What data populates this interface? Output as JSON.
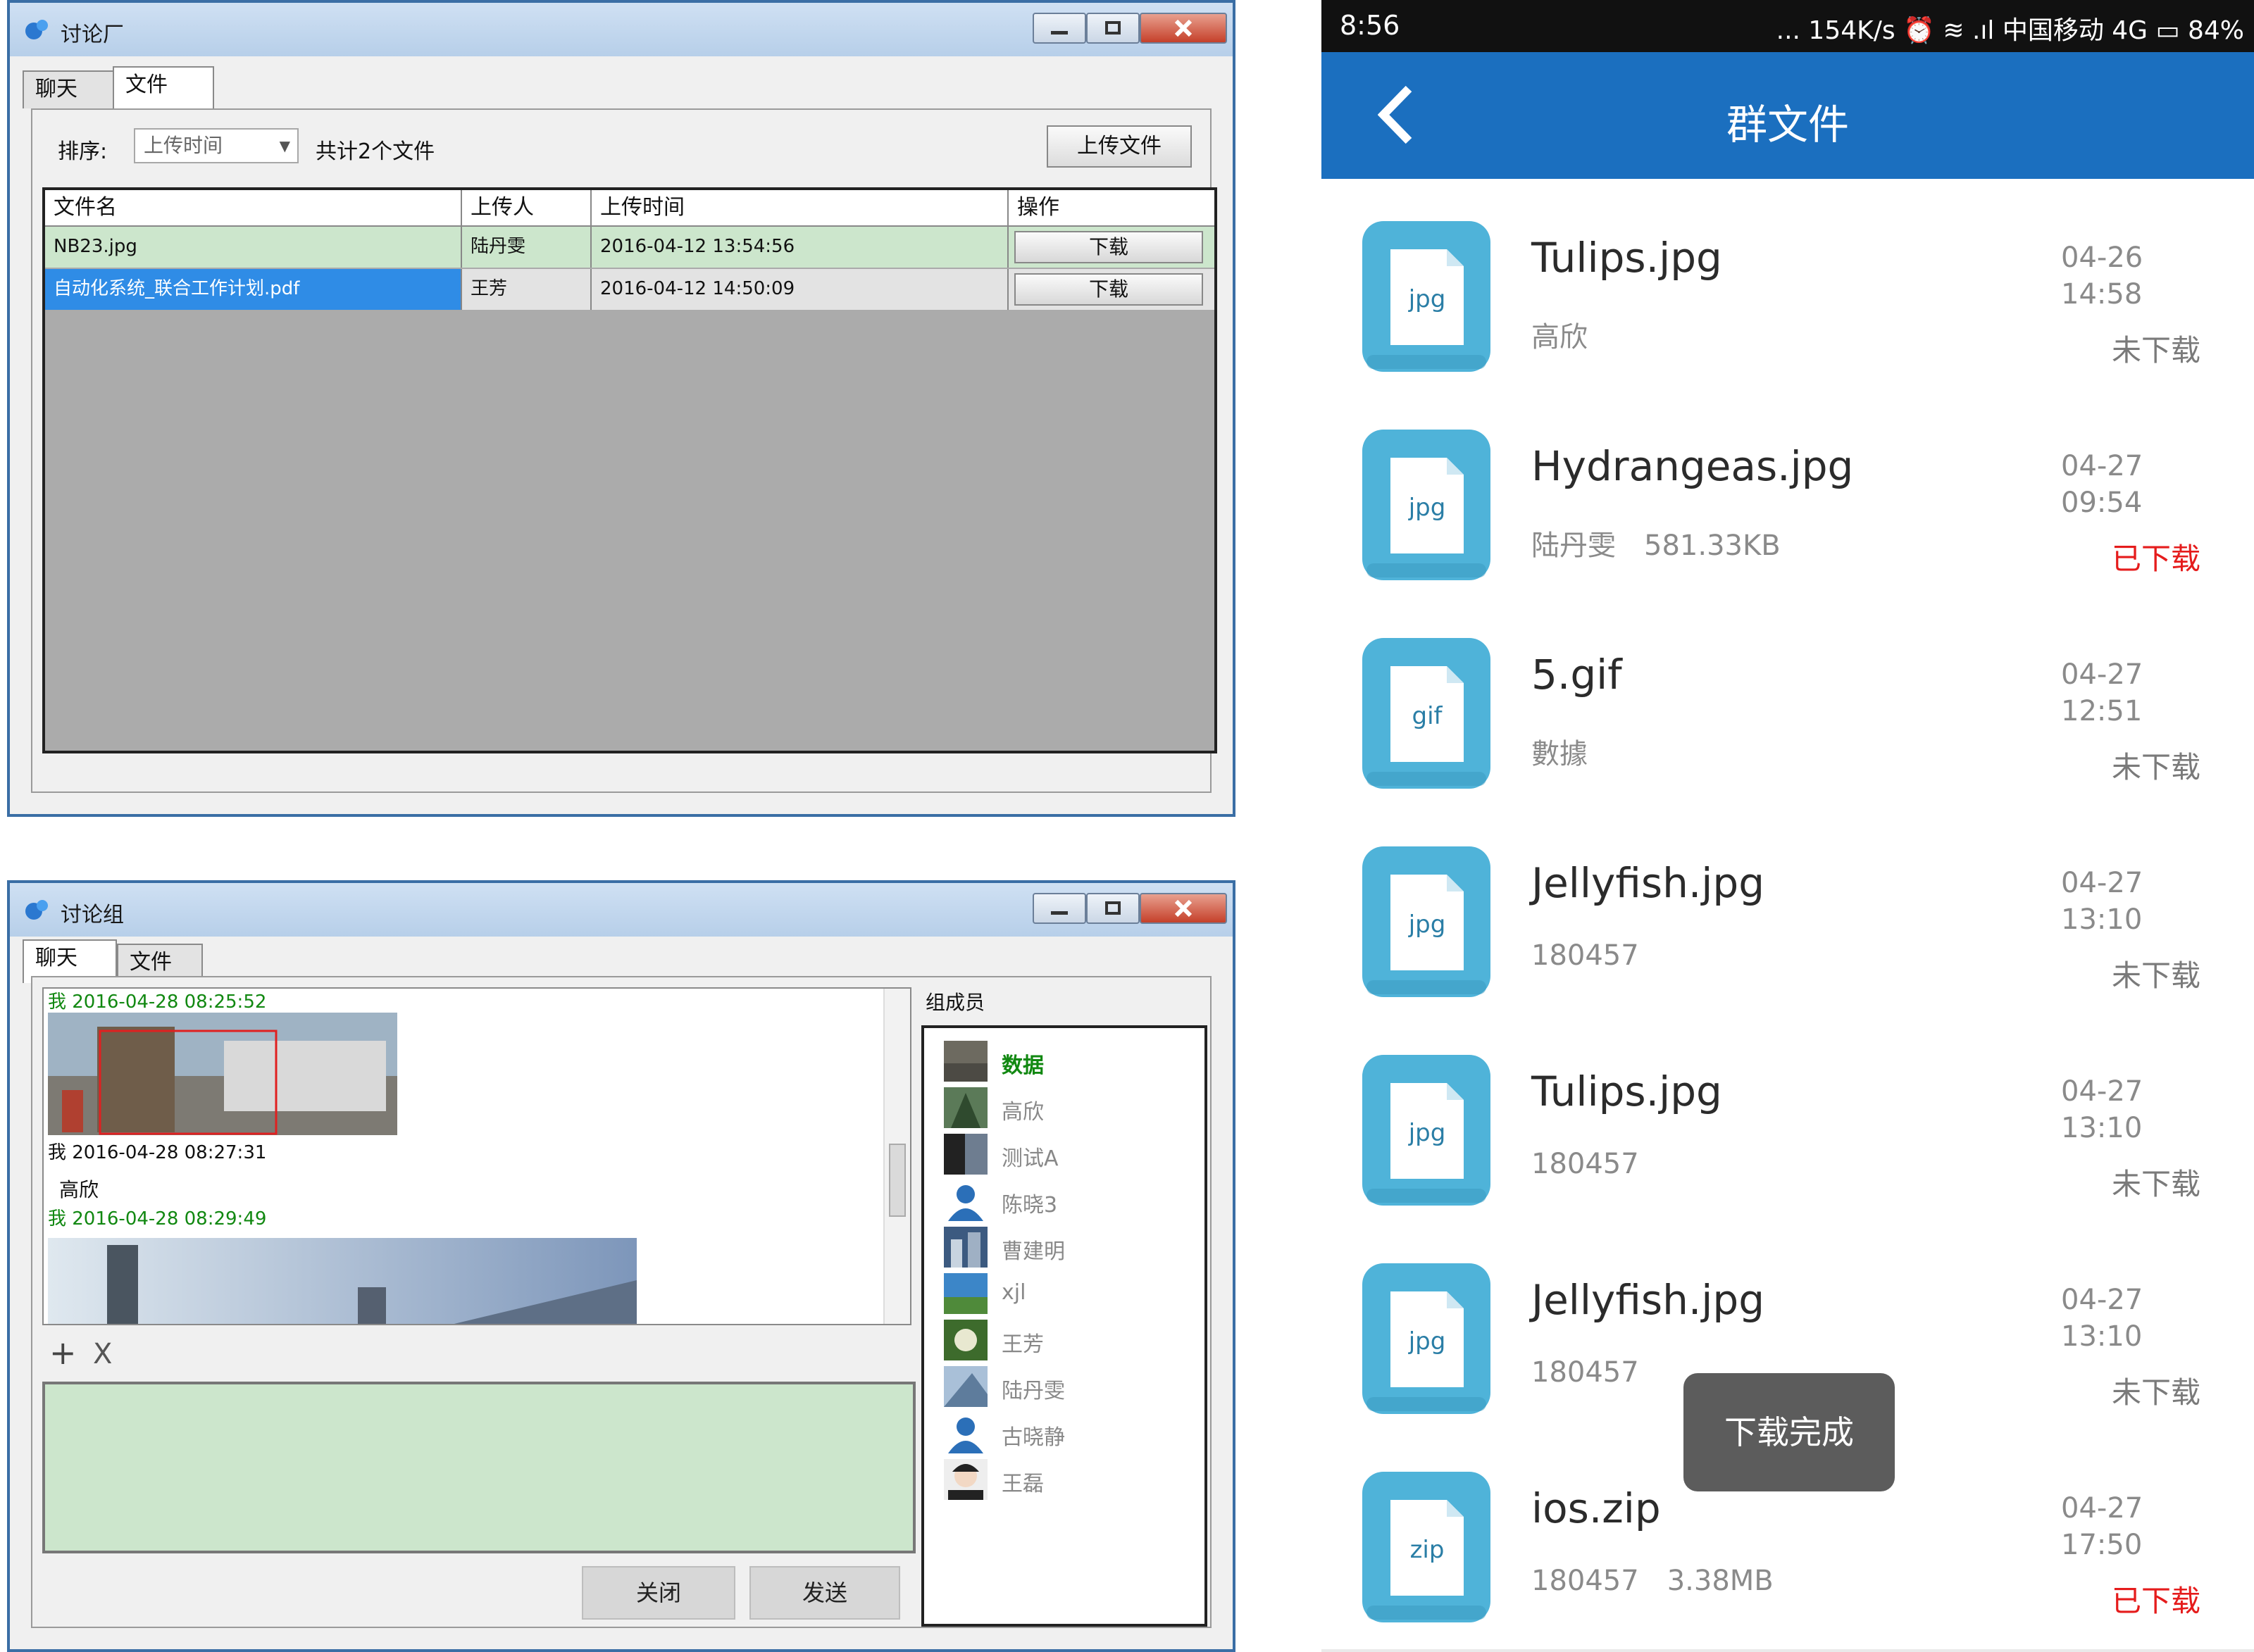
{
  "top_window": {
    "title": "讨论厂",
    "tabs": [
      "聊天",
      "文件"
    ],
    "active_tab": 1,
    "sort_label": "排序:",
    "sort_value": "上传时间",
    "file_count": "共计2个文件",
    "upload_button": "上传文件",
    "columns": [
      "文件名",
      "上传人",
      "上传时间",
      "操作"
    ],
    "rows": [
      {
        "name": "NB23.jpg",
        "uploader": "陆丹雯",
        "time": "2016-04-12 13:54:56",
        "action": "下载"
      },
      {
        "name": "自动化系统_联合工作计划.pdf",
        "uploader": "王芳",
        "time": "2016-04-12 14:50:09",
        "action": "下载"
      }
    ]
  },
  "bottom_window": {
    "title": "讨论组",
    "tabs": [
      "聊天",
      "文件"
    ],
    "active_tab": 0,
    "messages": [
      {
        "header": "我 2016-04-28 08:25:52"
      },
      {
        "header": "我 2016-04-28 08:27:31",
        "text": "高欣"
      },
      {
        "header": "我 2016-04-28 08:29:49"
      }
    ],
    "tool_add": "+",
    "tool_remove": "X",
    "close_button": "关闭",
    "send_button": "发送",
    "members_title": "组成员",
    "members": [
      "数据",
      "高欣",
      "测试A",
      "陈晓3",
      "曹建明",
      "xjl",
      "王芳",
      "陆丹雯",
      "古晓静",
      "王磊"
    ]
  },
  "phone": {
    "status": {
      "time": "8:56",
      "right": "... 154K/s ⏰ ≋ .ıl 中国移动 4G ▭ 84%"
    },
    "title": "群文件",
    "files": [
      {
        "ext": "jpg",
        "name": "Tulips.jpg",
        "uploader": "高欣",
        "size": "",
        "date": "04-26",
        "time": "14:58",
        "status": "未下载",
        "done": false
      },
      {
        "ext": "jpg",
        "name": "Hydrangeas.jpg",
        "uploader": "陆丹雯",
        "size": "581.33KB",
        "date": "04-27",
        "time": "09:54",
        "status": "已下载",
        "done": true
      },
      {
        "ext": "gif",
        "name": "5.gif",
        "uploader": "數據",
        "size": "",
        "date": "04-27",
        "time": "12:51",
        "status": "未下载",
        "done": false
      },
      {
        "ext": "jpg",
        "name": "Jellyfish.jpg",
        "uploader": "180457",
        "size": "",
        "date": "04-27",
        "time": "13:10",
        "status": "未下载",
        "done": false
      },
      {
        "ext": "jpg",
        "name": "Tulips.jpg",
        "uploader": "180457",
        "size": "",
        "date": "04-27",
        "time": "13:10",
        "status": "未下载",
        "done": false
      },
      {
        "ext": "jpg",
        "name": "Jellyfish.jpg",
        "uploader": "180457",
        "size": "",
        "date": "04-27",
        "time": "13:10",
        "status": "未下载",
        "done": false
      },
      {
        "ext": "zip",
        "name": "ios.zip",
        "uploader": "180457",
        "size": "3.38MB",
        "date": "04-27",
        "time": "17:50",
        "status": "已下载",
        "done": true
      }
    ],
    "toast": "下载完成"
  },
  "colors": {
    "phone_appbar": "#1b6fbf",
    "file_icon": "#4fb3d9",
    "downloaded_status": "#e51c1c",
    "desktop_row_highlight": "#cce6cc",
    "desktop_selection": "#2f8ce6"
  }
}
